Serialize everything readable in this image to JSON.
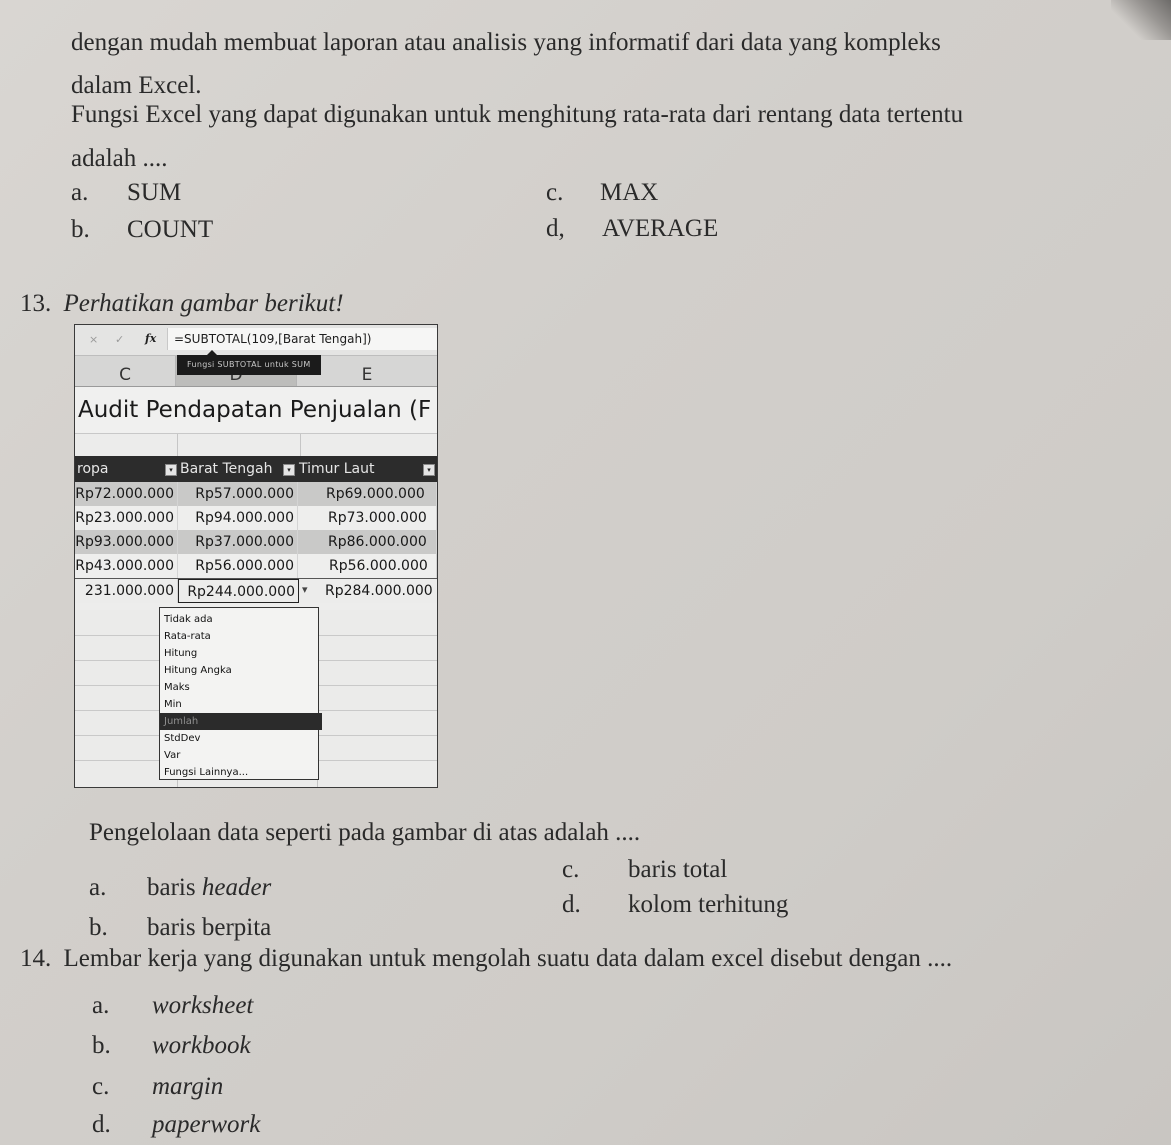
{
  "page": {
    "intro_lines": [
      "dengan mudah membuat laporan atau analisis yang informatif dari data yang kompleks",
      "dalam Excel."
    ],
    "question_12": {
      "text_lines": [
        "Fungsi Excel yang dapat digunakan untuk menghitung rata-rata dari rentang data tertentu",
        "adalah ...."
      ],
      "options": [
        {
          "letter": "a.",
          "text": "SUM"
        },
        {
          "letter": "b.",
          "text": "COUNT"
        },
        {
          "letter": "c.",
          "text": "MAX"
        },
        {
          "letter": "d,",
          "text": "AVERAGE"
        }
      ]
    },
    "question_13": {
      "number": "13.",
      "prompt": "Perhatikan gambar berikut!",
      "question": "Pengelolaan data seperti pada gambar di atas adalah ....",
      "options": [
        {
          "letter": "a.",
          "text": "baris ",
          "italic_text": "header"
        },
        {
          "letter": "b.",
          "text": "baris berpita"
        },
        {
          "letter": "c.",
          "text": "baris total"
        },
        {
          "letter": "d.",
          "text": "kolom terhitung"
        }
      ]
    },
    "question_14": {
      "number": "14.",
      "text": "Lembar kerja yang digunakan untuk mengolah suatu data dalam excel disebut dengan ....",
      "options": [
        {
          "letter": "a.",
          "text": "worksheet"
        },
        {
          "letter": "b.",
          "text": "workbook"
        },
        {
          "letter": "c.",
          "text": "margin"
        },
        {
          "letter": "d.",
          "text": "paperwork"
        }
      ]
    }
  },
  "excel": {
    "formula_bar": {
      "cancel_icon": "×",
      "enter_icon": "✓",
      "fx_label": "fx",
      "formula": "=SUBTOTAL(109,[Barat Tengah])"
    },
    "tooltip": "Fungsi SUBTOTAL untuk SUM",
    "column_letters": [
      "C",
      "D",
      "E"
    ],
    "title": "Audit Pendapatan Penjualan (F",
    "table": {
      "headers": [
        "ropa",
        "Barat Tengah",
        "Timur Laut"
      ],
      "filter_icon": "▾",
      "rows": [
        [
          "Rp72.000.000",
          "Rp57.000.000",
          "Rp69.000.000"
        ],
        [
          "Rp23.000.000",
          "Rp94.000.000",
          "Rp73.000.000"
        ],
        [
          "Rp93.000.000",
          "Rp37.000.000",
          "Rp86.000.000"
        ],
        [
          "Rp43.000.000",
          "Rp56.000.000",
          "Rp56.000.000"
        ]
      ],
      "total_row": [
        "231.000.000",
        "Rp244.000.000",
        "Rp284.000.000"
      ],
      "dropdown_icon": "▾"
    },
    "total_function_menu": {
      "items": [
        "Tidak ada",
        "Rata-rata",
        "Hitung",
        "Hitung Angka",
        "Maks",
        "Min",
        "Jumlah",
        "StdDev",
        "Var",
        "Fungsi Lainnya..."
      ],
      "selected": "Jumlah"
    }
  }
}
